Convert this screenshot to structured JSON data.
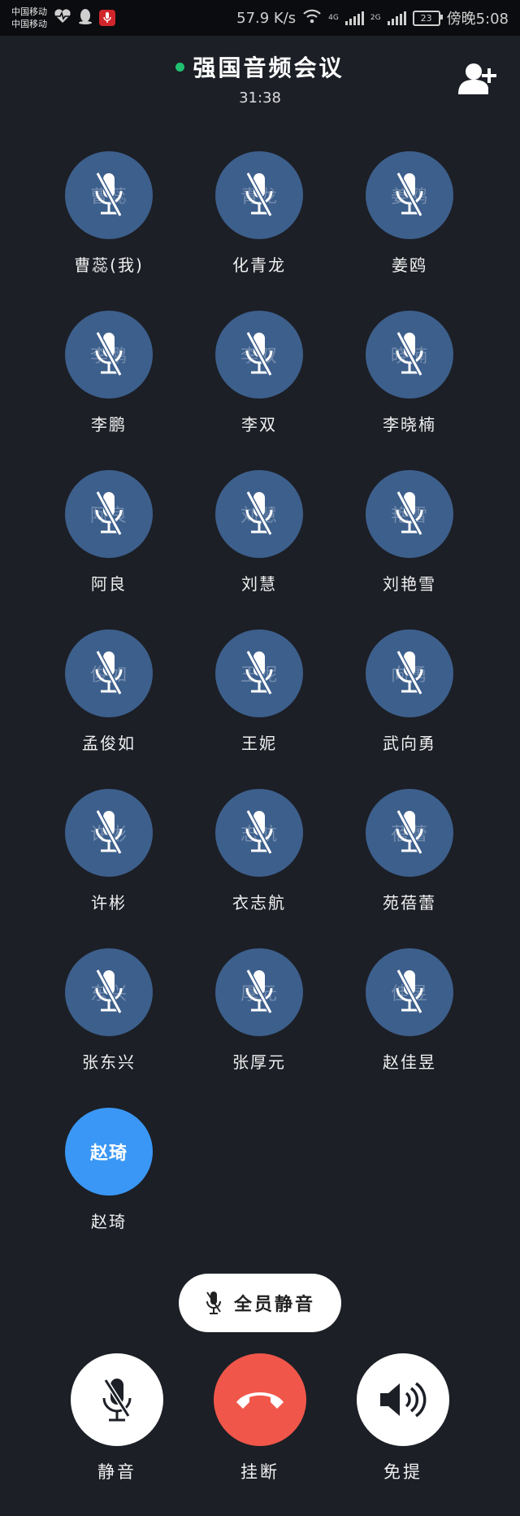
{
  "status_bar": {
    "carrier_1": "中国移动",
    "carrier_2": "中国移动",
    "speed": "57.9 K/s",
    "net_4g": "4G",
    "net_2g": "2G",
    "battery": "23",
    "time": "傍晚5:08"
  },
  "header": {
    "title": "强国音频会议",
    "timer": "31:38"
  },
  "participants": [
    {
      "name": "曹蕊(我)",
      "initial": "曹蕊",
      "muted": true
    },
    {
      "name": "化青龙",
      "initial": "青龙",
      "muted": true
    },
    {
      "name": "姜鸥",
      "initial": "姜鸥",
      "muted": true
    },
    {
      "name": "李鹏",
      "initial": "李鹏",
      "muted": true
    },
    {
      "name": "李双",
      "initial": "李双",
      "muted": true
    },
    {
      "name": "李晓楠",
      "initial": "晓楠",
      "muted": true
    },
    {
      "name": "阿良",
      "initial": "阿良",
      "muted": true
    },
    {
      "name": "刘慧",
      "initial": "刘慧",
      "muted": true
    },
    {
      "name": "刘艳雪",
      "initial": "艳雪",
      "muted": true
    },
    {
      "name": "孟俊如",
      "initial": "俊如",
      "muted": true
    },
    {
      "name": "王妮",
      "initial": "王妮",
      "muted": true
    },
    {
      "name": "武向勇",
      "initial": "向勇",
      "muted": true
    },
    {
      "name": "许彬",
      "initial": "许彬",
      "muted": true
    },
    {
      "name": "衣志航",
      "initial": "志航",
      "muted": true
    },
    {
      "name": "苑蓓蕾",
      "initial": "蓓蕾",
      "muted": true
    },
    {
      "name": "张东兴",
      "initial": "东兴",
      "muted": true
    },
    {
      "name": "张厚元",
      "initial": "厚元",
      "muted": true
    },
    {
      "name": "赵佳昱",
      "initial": "佳昱",
      "muted": true
    },
    {
      "name": "赵琦",
      "initial": "赵琦",
      "muted": false
    }
  ],
  "mute_all_label": "全员静音",
  "controls": {
    "mute_label": "静音",
    "hangup_label": "挂断",
    "speaker_label": "免提"
  },
  "colors": {
    "background": "#1c1f26",
    "avatar_muted": "#3d5f8c",
    "avatar_active": "#3a97f5",
    "hangup": "#f0574a",
    "live_dot": "#20c070"
  }
}
